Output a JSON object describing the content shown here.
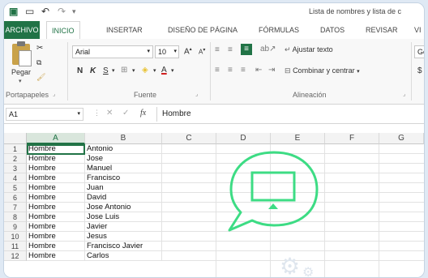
{
  "window": {
    "title": "Lista de nombres y lista de c"
  },
  "ribbon_tabs": [
    "ARCHIVO",
    "INICIO",
    "INSERTAR",
    "DISEÑO DE PÁGINA",
    "FÓRMULAS",
    "DATOS",
    "REVISAR",
    "VI"
  ],
  "ribbon": {
    "paste_label": "Pegar",
    "clipboard_label": "Portapapeles",
    "font_name": "Arial",
    "font_size": "10",
    "bold": "N",
    "italic": "K",
    "underline": "S",
    "increase_font": "A",
    "decrease_font": "A",
    "font_color": "A",
    "font_group_label": "Fuente",
    "wrap_text": "Ajustar texto",
    "merge_center": "Combinar y centrar",
    "alignment_label": "Alineación",
    "number_format": "Ge",
    "currency": "$"
  },
  "formula_bar": {
    "name_box": "A1",
    "fx": "fx",
    "content": "Hombre"
  },
  "columns": [
    "A",
    "B",
    "C",
    "D",
    "E",
    "F",
    "G"
  ],
  "rows": [
    {
      "n": "1",
      "a": "Hombre",
      "b": "Antonio"
    },
    {
      "n": "2",
      "a": "Hombre",
      "b": "Jose"
    },
    {
      "n": "3",
      "a": "Hombre",
      "b": "Manuel"
    },
    {
      "n": "4",
      "a": "Hombre",
      "b": "Francisco"
    },
    {
      "n": "5",
      "a": "Hombre",
      "b": "Juan"
    },
    {
      "n": "6",
      "a": "Hombre",
      "b": "David"
    },
    {
      "n": "7",
      "a": "Hombre",
      "b": "Jose Antonio"
    },
    {
      "n": "8",
      "a": "Hombre",
      "b": "Jose Luis"
    },
    {
      "n": "9",
      "a": "Hombre",
      "b": "Javier"
    },
    {
      "n": "10",
      "a": "Hombre",
      "b": "Jesus"
    },
    {
      "n": "11",
      "a": "Hombre",
      "b": "Francisco Javier"
    },
    {
      "n": "12",
      "a": "Hombre",
      "b": "Carlos"
    }
  ],
  "colors": {
    "accent": "#217346",
    "overlay_icon": "#3ddc84"
  },
  "overlay": {
    "icon": "chat-bubble-monitor-icon"
  }
}
